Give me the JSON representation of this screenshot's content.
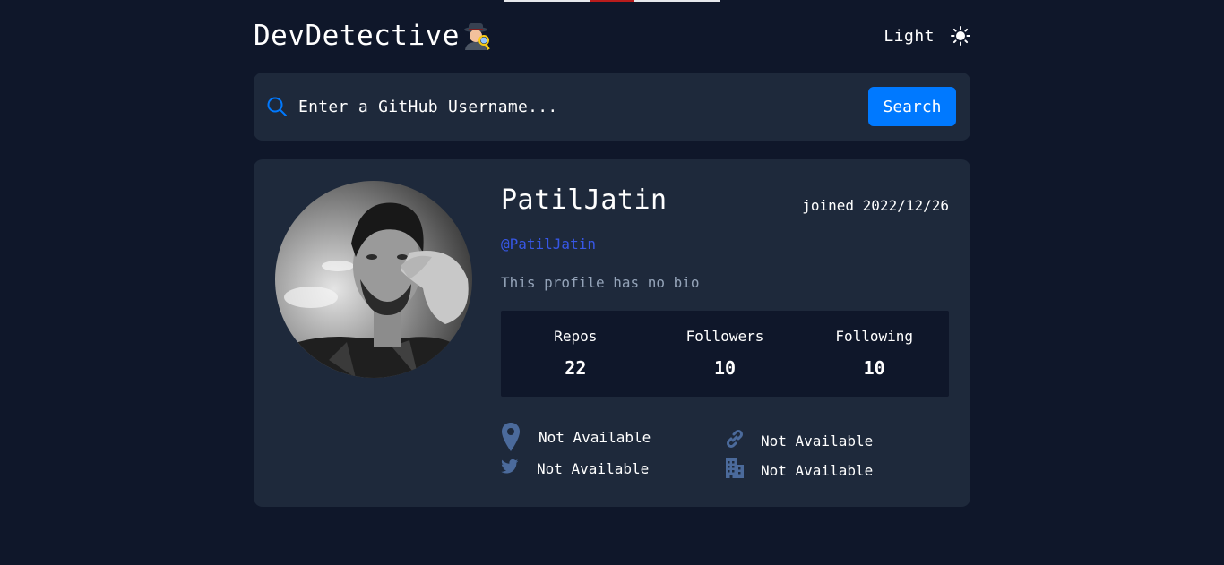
{
  "header": {
    "brand": "DevDetective",
    "theme_label": "Light",
    "brand_emoji_icon": "detective-emoji-icon",
    "theme_icon": "sun-icon"
  },
  "search": {
    "placeholder": "Enter a GitHub Username...",
    "button_label": "Search",
    "icon": "search-icon"
  },
  "profile": {
    "name": "PatilJatin",
    "joined": "joined 2022/12/26",
    "username": "@PatilJatin",
    "bio": "This profile has no bio",
    "stats": [
      {
        "label": "Repos",
        "value": "22"
      },
      {
        "label": "Followers",
        "value": "10"
      },
      {
        "label": "Following",
        "value": "10"
      }
    ],
    "links": {
      "location": "Not Available",
      "website": "Not Available",
      "twitter": "Not Available",
      "company": "Not Available"
    }
  },
  "colors": {
    "background": "#0f172a",
    "card": "#1e293b",
    "accent": "#0079ff",
    "username": "#3757e6",
    "muted": "#94a3b8",
    "icon": "#4b6a9b"
  }
}
